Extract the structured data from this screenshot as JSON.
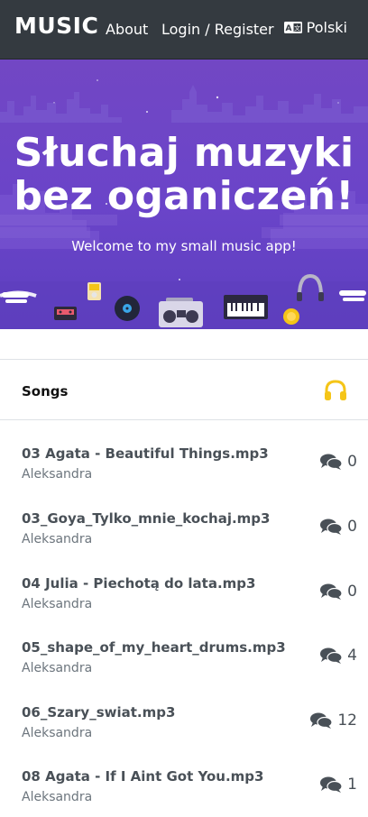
{
  "navbar": {
    "brand": "MUSIC",
    "about": "About",
    "login": "Login / Register",
    "language": "Polski"
  },
  "hero": {
    "title_line1": "Słuchaj muzyki",
    "title_line2": "bez oganiczeń!",
    "subtitle": "Welcome to my small music app!"
  },
  "songs": {
    "header": "Songs",
    "items": [
      {
        "title": "03 Agata - Beautiful Things.mp3",
        "author": "Aleksandra",
        "comments": "0"
      },
      {
        "title": "03_Goya_Tylko_mnie_kochaj.mp3",
        "author": "Aleksandra",
        "comments": "0"
      },
      {
        "title": "04 Julia - Piechotą do lata.mp3",
        "author": "Aleksandra",
        "comments": "0"
      },
      {
        "title": "05_shape_of_my_heart_drums.mp3",
        "author": "Aleksandra",
        "comments": "4"
      },
      {
        "title": "06_Szary_swiat.mp3",
        "author": "Aleksandra",
        "comments": "12"
      },
      {
        "title": "08 Agata - If I Aint Got You.mp3",
        "author": "Aleksandra",
        "comments": "1"
      }
    ]
  },
  "colors": {
    "navbar": "#343a40",
    "hero": "#6a44c9",
    "accent": "#f5c518"
  }
}
